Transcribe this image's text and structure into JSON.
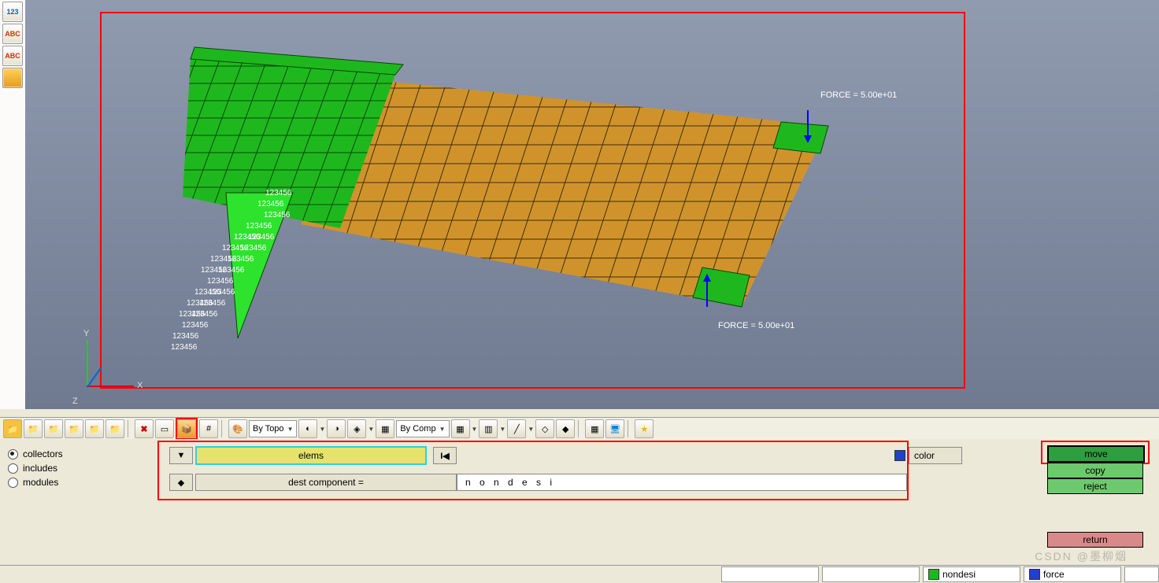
{
  "viewport": {
    "force_label_1": "FORCE =  5.00e+01",
    "force_label_2": "FORCE =  5.00e+01",
    "axis_x": "X",
    "axis_y": "Y",
    "axis_z": "Z",
    "constraint_label": "123456"
  },
  "toolbar2": {
    "bytopo": "By Topo",
    "bycomp": "By Comp"
  },
  "panel": {
    "radios": {
      "collectors": "collectors",
      "includes": "includes",
      "modules": "modules"
    },
    "elems_label": "elems",
    "reset_icon": "I◀",
    "color_label": "color",
    "dest_label": "dest component =",
    "dest_value": "n  o  n  d  e  s  i",
    "sort_icon": "◆"
  },
  "actions": {
    "move": "move",
    "copy": "copy",
    "reject": "reject",
    "return": "return"
  },
  "status": {
    "comp1_label": "nondesi",
    "comp2_label": "force"
  },
  "left_tools": {
    "t1": "123",
    "t2": "ABC",
    "t3": "ABC"
  },
  "watermark": "CSDN @墨柳烟"
}
